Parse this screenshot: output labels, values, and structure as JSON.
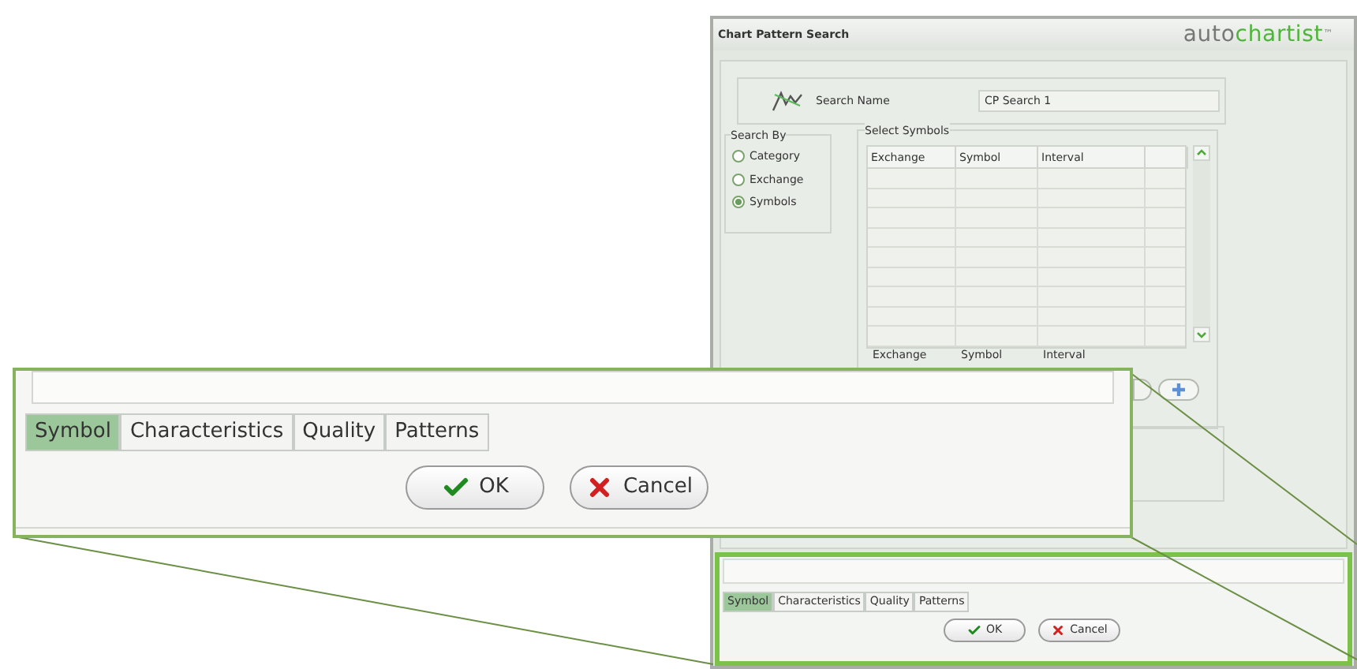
{
  "window": {
    "title": "Chart Pattern Search",
    "logo": {
      "prefix": "auto",
      "main": "chartist",
      "mark": "™"
    }
  },
  "search_name": {
    "label": "Search Name",
    "value": "CP Search 1"
  },
  "search_by": {
    "title": "Search By",
    "options": [
      {
        "label": "Category",
        "selected": false
      },
      {
        "label": "Exchange",
        "selected": false
      },
      {
        "label": "Symbols",
        "selected": true
      }
    ]
  },
  "select_symbols": {
    "title": "Select Symbols",
    "columns": [
      "Exchange",
      "Symbol",
      "Interval"
    ],
    "entry_labels": [
      "Exchange",
      "Symbol",
      "Interval"
    ]
  },
  "bottom": {
    "tabs": [
      {
        "label": "Symbol",
        "selected": true
      },
      {
        "label": "Characteristics",
        "selected": false
      },
      {
        "label": "Quality",
        "selected": false
      },
      {
        "label": "Patterns",
        "selected": false
      }
    ],
    "buttons": [
      {
        "label": "OK",
        "kind": "ok"
      },
      {
        "label": "Cancel",
        "kind": "cancel"
      }
    ]
  },
  "callout": {
    "tabs": [
      {
        "label": "Symbol",
        "selected": true
      },
      {
        "label": "Characteristics",
        "selected": false
      },
      {
        "label": "Quality",
        "selected": false
      },
      {
        "label": "Patterns",
        "selected": false
      }
    ],
    "buttons": [
      {
        "label": "OK",
        "kind": "ok"
      },
      {
        "label": "Cancel",
        "kind": "cancel"
      }
    ]
  }
}
